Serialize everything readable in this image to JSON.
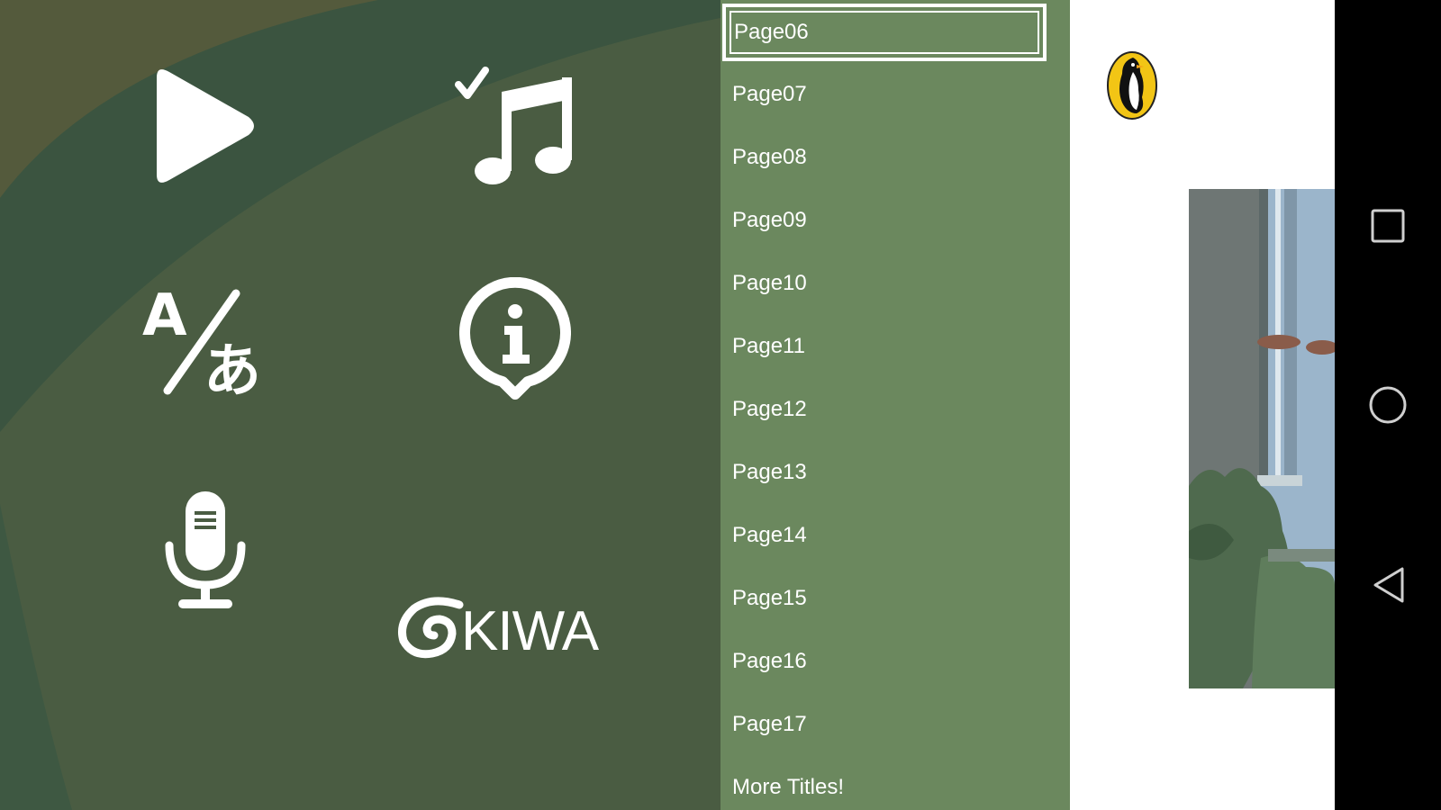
{
  "menu": {
    "selected_index": 0,
    "items": [
      {
        "label": "Page06"
      },
      {
        "label": "Page07"
      },
      {
        "label": "Page08"
      },
      {
        "label": "Page09"
      },
      {
        "label": "Page10"
      },
      {
        "label": "Page11"
      },
      {
        "label": "Page12"
      },
      {
        "label": "Page13"
      },
      {
        "label": "Page14"
      },
      {
        "label": "Page15"
      },
      {
        "label": "Page16"
      },
      {
        "label": "Page17"
      },
      {
        "label": "More Titles!"
      }
    ]
  },
  "brand": {
    "logo_text": "KIWA"
  },
  "icons": {
    "play": "play-icon",
    "music_check": "music-check-icon",
    "translate": "translate-icon",
    "info": "info-icon",
    "microphone": "microphone-icon",
    "publisher_logo": "penguin-logo-icon",
    "recents": "square-icon",
    "home": "circle-icon",
    "back": "triangle-back-icon"
  },
  "colors": {
    "menu_bg": "#6b885e",
    "panel_bg": "#3e5a40",
    "icon": "#ffffff",
    "nav_bar": "#000000"
  }
}
